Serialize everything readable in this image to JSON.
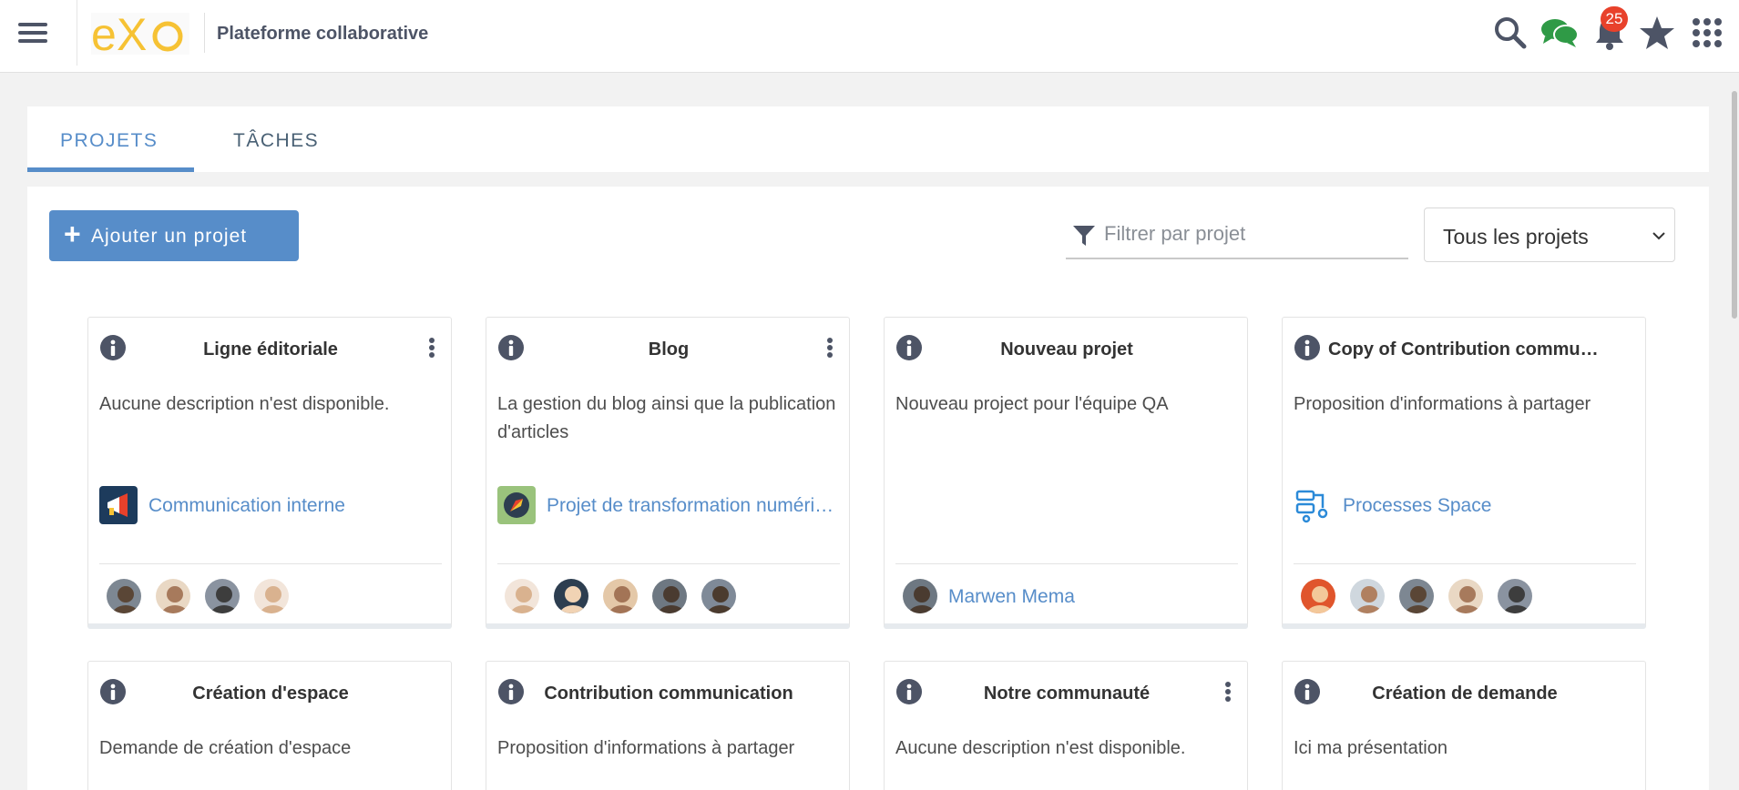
{
  "header": {
    "app_title": "Plateforme collaborative",
    "notification_count": "25",
    "logo_text": "eXo",
    "icons": [
      "menu-icon",
      "search-icon",
      "chat-icon",
      "bell-icon",
      "star-icon",
      "apps-grid-icon"
    ]
  },
  "tabs": [
    {
      "label": "PROJETS",
      "active": true
    },
    {
      "label": "TÂCHES",
      "active": false
    }
  ],
  "toolbar": {
    "add_label": "Ajouter un projet",
    "filter_placeholder": "Filtrer par projet",
    "filter_value": "",
    "select_value": "Tous les projets"
  },
  "colors": {
    "accent": "#578dc9",
    "logo": "#f6c234",
    "badge": "#e8412b",
    "chat": "#2f9a46"
  },
  "projects": [
    {
      "title": "Ligne éditoriale",
      "description": "Aucune description n'est disponible.",
      "space": "Communication interne",
      "space_icon": "megaphone-icon",
      "members": 4,
      "has_menu": true
    },
    {
      "title": "Blog",
      "description": "La gestion du blog ainsi que la publication d'articles",
      "space": "Projet de transformation numérique",
      "space_icon": "rocket-icon",
      "members": 5,
      "has_menu": true
    },
    {
      "title": "Nouveau projet",
      "description": "Nouveau project pour l'équipe QA",
      "space": "",
      "manager": "Marwen Mema",
      "members": 1,
      "has_menu": false
    },
    {
      "title": "Copy of Contribution communication",
      "description": "Proposition d'informations à partager",
      "space": "Processes Space",
      "space_icon": "process-flow-icon",
      "members": 5,
      "has_menu": false
    },
    {
      "title": "Création d'espace",
      "description": "Demande de création d'espace",
      "has_menu": false
    },
    {
      "title": "Contribution communication",
      "description": "Proposition d'informations à partager",
      "has_menu": false
    },
    {
      "title": "Notre communauté",
      "description": "Aucune description n'est disponible.",
      "has_menu": true
    },
    {
      "title": "Création de demande",
      "description": "Ici ma présentation",
      "has_menu": false
    }
  ]
}
